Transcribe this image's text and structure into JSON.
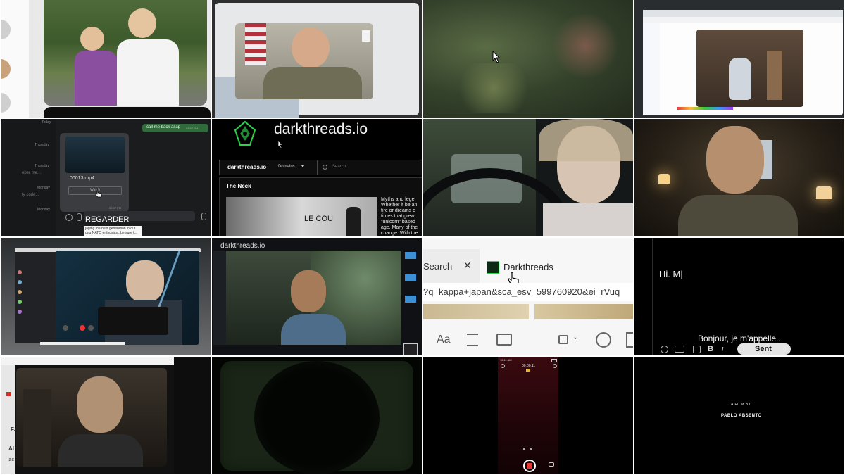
{
  "tile5": {
    "chat_days": [
      "Today",
      "Thursday",
      "Thursday",
      "Monday",
      "Monday"
    ],
    "chat_snips": [
      "ober me...",
      "ty code..."
    ],
    "bubble_text": "call me back asap",
    "bubble_time": "02:57 PM",
    "file_name": "00013.mp4",
    "watch_label": "Watch",
    "msg_time": "02:07 PM",
    "subtitle": "REGARDER",
    "caption_line1": "jaging the next generation in our",
    "caption_line2": "ung NATO enthusiast, be sure t..."
  },
  "tile6": {
    "site_title": "darkthreads.io",
    "nav_brand": "darkthreads.io",
    "nav_domains": "Domains",
    "search_placeholder": "Search",
    "section_title": "The Neck",
    "overlay_text": "LE COU",
    "article_lines": [
      "Myths and leger",
      "Whether it be an",
      "fire or dreams o",
      "times that grew",
      "\"unicorn\" based",
      "age. Many of the",
      "change. With the"
    ]
  },
  "tile10": {
    "site_label": "darkthreads.io"
  },
  "tile11": {
    "search_tab": "Search",
    "active_tab": "Darkthreads",
    "url": "?q=kappa+japan&sca_esv=599760920&ei=rVuq",
    "toolbar_aa": "Aa"
  },
  "tile12": {
    "typed_text": "Hi. M|",
    "subtitle": "Bonjour, je m'appelle...",
    "bold_label": "B",
    "italic_label": "i",
    "send_label": "Sent"
  },
  "tile13": {
    "side_labels": [
      "Fa",
      "Al",
      "jac"
    ]
  },
  "tile15": {
    "clock": "12:11 AM",
    "timer": "00:00:11"
  },
  "tile16": {
    "credit_line1": "A FILM BY",
    "credit_line2": "PABLO ABSENTO"
  }
}
